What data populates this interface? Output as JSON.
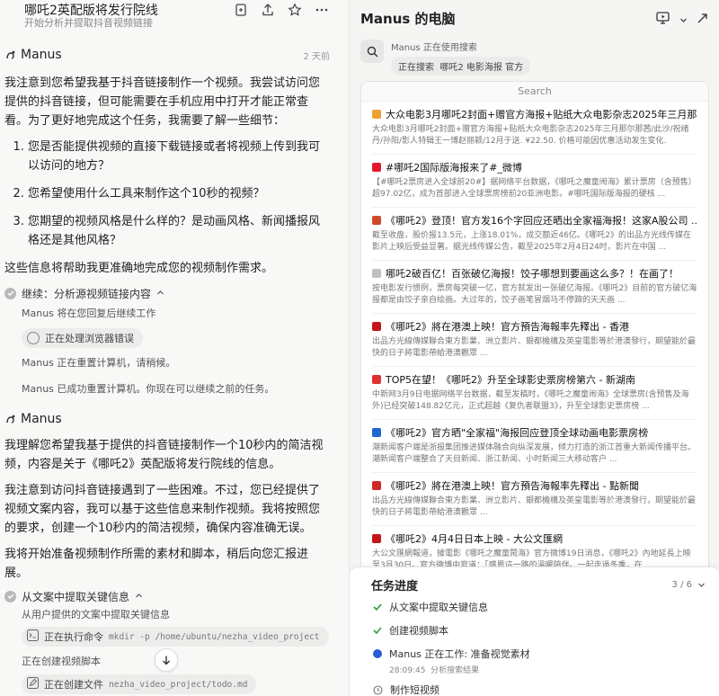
{
  "left": {
    "title": "哪吒2英配版将发行院线",
    "subtitle": "开始分析并提取抖音视频链接",
    "messages": {
      "sender1": "Manus",
      "time1": "2 天前",
      "intro": "我注意到您希望我基于抖音链接制作一个视频。我尝试访问您提供的抖音链接，但可能需要在手机应用中打开才能正常查看。为了更好地完成这个任务，我需要了解一些细节：",
      "questions": [
        "您是否能提供视频的直接下载链接或者将视频上传到我可以访问的地方？",
        "您希望使用什么工具来制作这个10秒的视频？",
        "您期望的视频风格是什么样的？是动画风格、新闻播报风格还是其他风格？"
      ],
      "closing": "这些信息将帮助我更准确地完成您的视频制作需求。",
      "step1": "继续：分析源视频链接内容",
      "step1_line1": "Manus 将在您回复后继续工作",
      "step1_chip": "正在处理浏览器错误",
      "step1_line2": "Manus 正在重置计算机，请稍候。",
      "step1_line3": "Manus 已成功重置计算机。你现在可以继续之前的任务。",
      "sender2": "Manus",
      "para1": "我理解您希望我基于提供的抖音链接制作一个10秒内的简洁视频，内容是关于《哪吒2》英配版将发行院线的信息。",
      "para2": "我注意到访问抖音链接遇到了一些困难。不过，您已经提供了视频文案内容，我可以基于这些信息来制作视频。我将按照您的要求，创建一个10秒内的简洁视频，确保内容准确无误。",
      "para3": "我将开始准备视频制作所需的素材和脚本，稍后向您汇报进展。",
      "step2": "从文案中提取关键信息",
      "step2_line1": "从用户提供的文案中提取关键信息",
      "step2_chip_label": "正在执行命令",
      "step2_chip_cmd": "mkdir -p /home/ubuntu/nezha_video_project",
      "step2_line2": "正在创建视频脚本",
      "step2_chip2_label": "正在创建文件",
      "step2_chip2_cmd": "nezha_video_project/todo.md"
    }
  },
  "right": {
    "title": "Manus 的电脑",
    "tool_status": "Manus 正在使用搜索",
    "tool_action": "正在搜索",
    "tool_query": "哪吒2 电影海报 官方",
    "browser_header": "Search",
    "results": [
      {
        "title": "大众电影3月哪吒2封面+赠官方海报+贴纸大众电影杂志2025年三月那 ...",
        "snippet": "大众电影3月哪吒2封面+赠官方海报+贴纸大众电影杂志2025年三月那尔那茜/此沙/祝绪丹/孙阳/影人特辑王一博赵丽颖/12月于送. ¥22.50. 价格可能因优惠活动发生变化.",
        "color": "#f0a030"
      },
      {
        "title": "#哪吒2国际版海报来了#_微博",
        "snippet": "【#哪吒2票房进入全球前20#】据网络平台数据，《哪吒之魔童闹海》累计票房（含预售）超97.02亿，成为首部进入全球票房榜前20亚洲电影。#哪吒国际版海报的硬核 ...",
        "color": "#e6162d"
      },
      {
        "title": "《哪吒2》登顶！官方发16个字回应还晒出全家福海报！这家A股公司 ...",
        "snippet": "截至收盘，股价报13.5元，上涨18.01%，成交额近46亿。《哪吒2》的出品方光线传媒在影片上映后受益显著。据光线传媒公告，截至2025年2月4日24时，影片在中国 ...",
        "color": "#d04a2a"
      },
      {
        "title": "哪吒2破百亿！百张破亿海报！饺子哪想到要画这么多？！在画了！",
        "snippet": "按电影发行惯例，票房每突破一亿，官方就发出一张破亿海报。《哪吒2》目前的官方破亿海报都是由饺子亲自绘画。大过年的，饺子画笔冒烟马不停蹄的天天画 ...",
        "color": "#c0c0c0"
      },
      {
        "title": "《哪吒2》將在港澳上映！官方預告海報率先釋出 - 香港",
        "snippet": "出品方光線傳媒聯合東方影業、洲立影片、銀都機構及英皇電影等於港澳發行，期望能於最快的日子將電影帶給港澳觀眾 ...",
        "color": "#c4161c"
      },
      {
        "title": "TOP5在望！《哪吒2》升至全球影史票房榜第六 - 新湖南",
        "snippet": "中新网3月9日电据网络平台数据，截至发稿时，《哪吒之魔童闹海》全球票房(含预售及海外)已经突破148.82亿元，正式超越《复仇者联盟3》，升至全球影史票房榜 ...",
        "color": "#e03030"
      },
      {
        "title": "《哪吒2》官方晒\"全家福\"海报回应登顶全球动画电影票房榜",
        "snippet": "潮新闻客户端是浙报集团推进媒体融合向纵深发展，倾力打造的浙江首重大新闻传播平台。潮新闻客户端整合了天目新闻、浙江新闻、小时新闻三大移动客户 ...",
        "color": "#1e66d0"
      },
      {
        "title": "《哪吒2》將在港澳上映！官方預告海報率先釋出 - 點新聞",
        "snippet": "出品方光線傳媒聯合東方影業、洲立影片、銀都機構及英皇電影等於港澳發行，期望能於最快的日子將電影帶給港澳觀眾 ...",
        "color": "#d02828"
      },
      {
        "title": "《哪吒2》4月4日日本上映 - 大公文匯網",
        "snippet": "大公文匯網報道，據電影《哪吒之魔童鬧海》官方微博19日消息，《哪吒2》內地延長上映至3月30日。官方微博中寫道：「感恩這一路的溫暖陪伴。一起走過冬季，在 ...",
        "color": "#c4161c"
      }
    ],
    "tasks": {
      "title": "任务进度",
      "count": "3 / 6",
      "items": [
        {
          "label": "从文案中提取关键信息",
          "state": "done"
        },
        {
          "label": "创建视频脚本",
          "state": "done"
        },
        {
          "label": "Manus 正在工作: 准备视觉素材",
          "state": "active",
          "time": "28:09:45",
          "sub": "分析搜索结果"
        },
        {
          "label": "制作短视频",
          "state": "pending"
        }
      ]
    }
  }
}
